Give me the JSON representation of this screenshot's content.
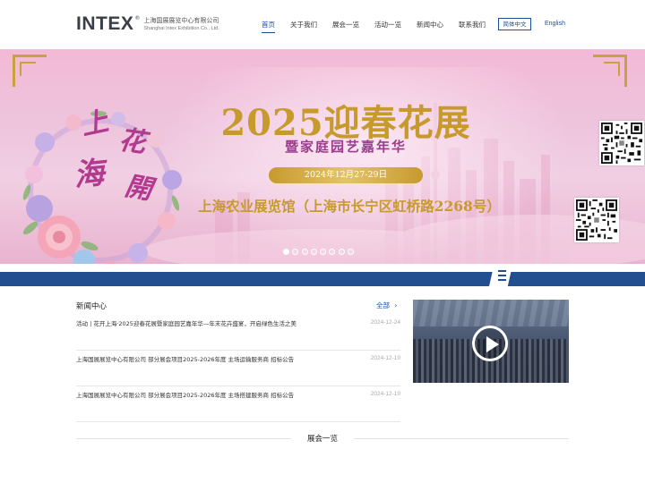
{
  "header": {
    "logo_mark": "INTEX",
    "logo_reg": "®",
    "company_cn": "上海国展展览中心有限公司",
    "company_en": "Shanghai Intex Exhibition Co., Ltd.",
    "nav": [
      {
        "label": "首页",
        "active": true
      },
      {
        "label": "关于我们",
        "active": false
      },
      {
        "label": "展会一览",
        "active": false
      },
      {
        "label": "活动一览",
        "active": false
      },
      {
        "label": "新闻中心",
        "active": false
      },
      {
        "label": "联系我们",
        "active": false
      }
    ],
    "lang_cn": "简体中文",
    "lang_en": "English"
  },
  "banner": {
    "wreath_chars": [
      "上",
      "花",
      "海",
      "開"
    ],
    "title": "2025迎春花展",
    "subtitle": "暨家庭园艺嘉年华",
    "date": "2024年12月27-29日",
    "venue": "上海农业展览馆（上海市长宁区虹桥路2268号）",
    "slide_count": 8,
    "active_slide": 1
  },
  "news": {
    "heading": "新闻中心",
    "more": "全部",
    "items": [
      {
        "title": "活动 | 花开上海·2025迎春花展暨家庭园艺嘉年华—年末花卉盛宴，开启绿色生活之美",
        "date": "2024-12-24"
      },
      {
        "title": "上海国展展览中心有限公司 部分展会项目2025-2026年度 主场运输服务商 招标公告",
        "date": "2024-12-19"
      },
      {
        "title": "上海国展展览中心有限公司 部分展会项目2025-2026年度 主场搭建服务商 招标公告",
        "date": "2024-12-19"
      }
    ]
  },
  "exhibitions": {
    "heading": "展会一览"
  },
  "colors": {
    "brand_blue": "#1b4fa0",
    "strip_blue": "#234e8f",
    "gold": "#c79a2e",
    "magenta": "#9b3d8c"
  }
}
